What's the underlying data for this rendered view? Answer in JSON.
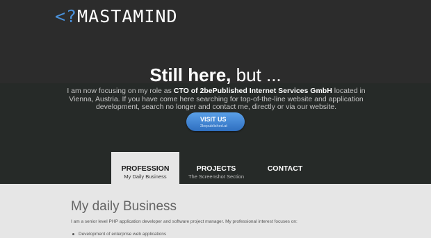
{
  "logo": {
    "prefix": "<?",
    "name": "MASTAMIND"
  },
  "headline": {
    "bold": "Still here,",
    "light": " but ..."
  },
  "intro": {
    "before": "I am now focusing on my role as ",
    "highlight": "CTO of 2bePublished Internet Services GmbH",
    "after": " located in Vienna, Austria. If you have come here searching for top-of-the-line website and application development, search no longer and contact me, directly or via our website."
  },
  "visit_button": {
    "label": "VISIT US",
    "sublabel": "2bepublished.at"
  },
  "tabs": [
    {
      "label": "PROFESSION",
      "sublabel": "My Daily Business",
      "active": true
    },
    {
      "label": "PROJECTS",
      "sublabel": "The Screenshot Section",
      "active": false
    },
    {
      "label": "CONTACT",
      "sublabel": "",
      "active": false
    }
  ],
  "content": {
    "title": "My daily Business",
    "paragraph": "I am a senior level PHP application developer and software project manager. My professional interest focuses on:",
    "items": [
      "Development of enterprise web applications"
    ]
  },
  "colors": {
    "accent": "#4a90d9",
    "header_bg": "#2c2c2c",
    "band_bg": "#262a28",
    "content_bg": "#e6e6e6"
  }
}
